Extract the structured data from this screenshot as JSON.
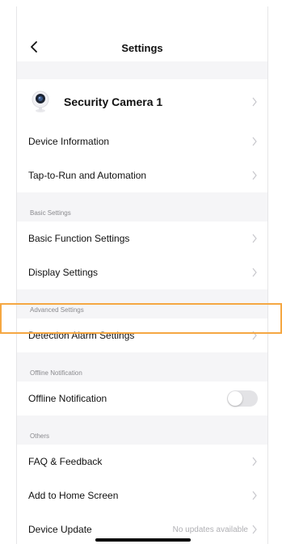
{
  "header": {
    "title": "Settings"
  },
  "device": {
    "name": "Security Camera 1"
  },
  "rows_top": [
    {
      "label": "Device Information"
    },
    {
      "label": "Tap-to-Run and Automation"
    }
  ],
  "sections": {
    "basic": "Basic Settings",
    "advanced": "Advanced Settings",
    "offline": "Offline Notification",
    "others": "Others"
  },
  "basic_rows": [
    {
      "label": "Basic Function Settings"
    },
    {
      "label": "Display Settings"
    }
  ],
  "advanced_rows": [
    {
      "label": "Detection Alarm Settings"
    }
  ],
  "offline_row": {
    "label": "Offline Notification",
    "toggle_on": false
  },
  "others_rows": [
    {
      "label": "FAQ & Feedback"
    },
    {
      "label": "Add to Home Screen"
    },
    {
      "label": "Device Update",
      "value": "No updates available"
    }
  ],
  "colors": {
    "highlight": "#f5a742",
    "background": "#f5f5f7"
  }
}
